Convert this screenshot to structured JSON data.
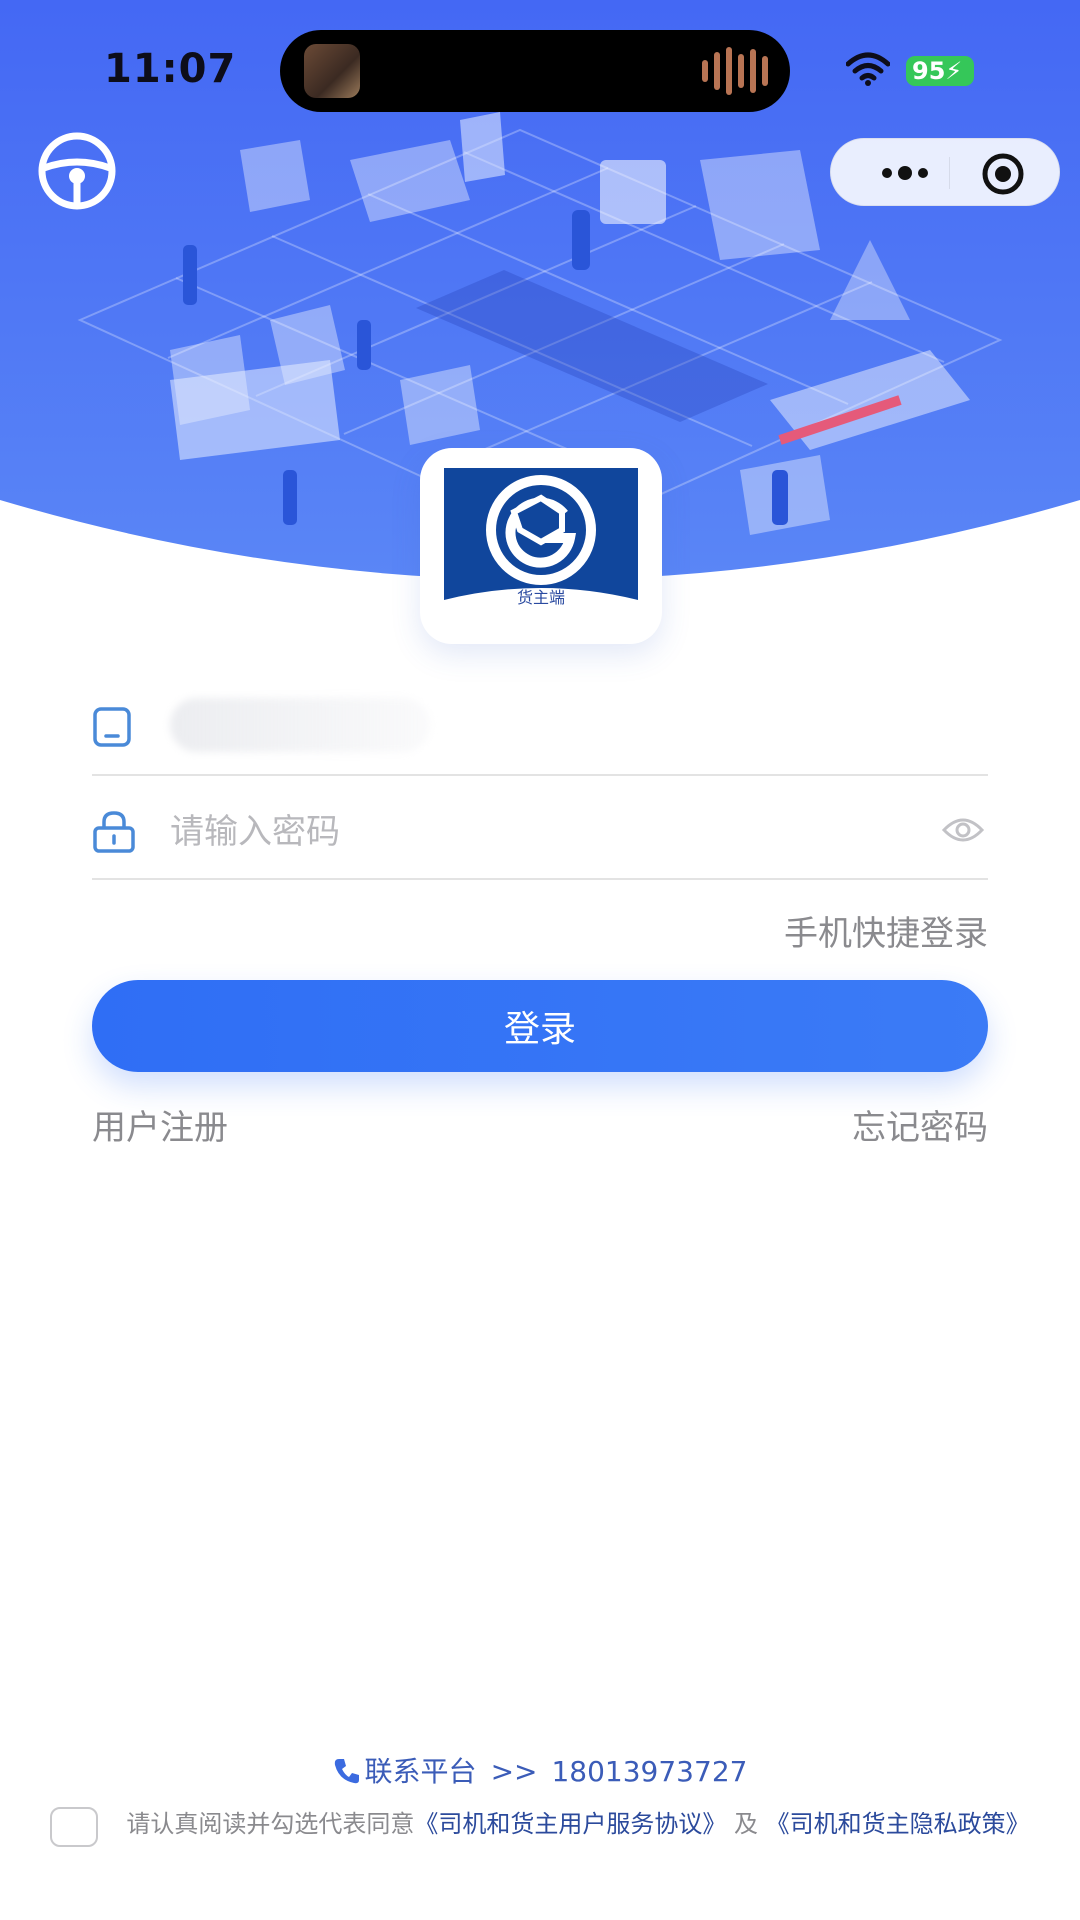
{
  "status_bar": {
    "time": "11:07",
    "battery": "95"
  },
  "logo": {
    "caption": "货主端"
  },
  "login_form": {
    "password_placeholder": "请输入密码",
    "quick_login": "手机快捷登录",
    "login_button": "登录",
    "register": "用户注册",
    "forgot_password": "忘记密码"
  },
  "footer": {
    "contact_label": "联系平台",
    "contact_arrows": ">>",
    "contact_phone": "18013973727",
    "agreement_prefix": "请认真阅读并勾选代表同意",
    "service_agreement": "《司机和货主用户服务协议》",
    "agreement_and": "及",
    "privacy_policy": "《司机和货主隐私政策》"
  },
  "colors": {
    "hero_blue": "#4a72f5",
    "primary": "#2f6ef5",
    "link": "#2b4a9c",
    "logo_navy": "#10469c",
    "battery_green": "#35c759"
  },
  "icons": [
    "steering-wheel-icon",
    "more-icon",
    "record-icon",
    "tablet-icon",
    "lock-icon",
    "eye-icon",
    "phone-icon",
    "wifi-icon"
  ]
}
